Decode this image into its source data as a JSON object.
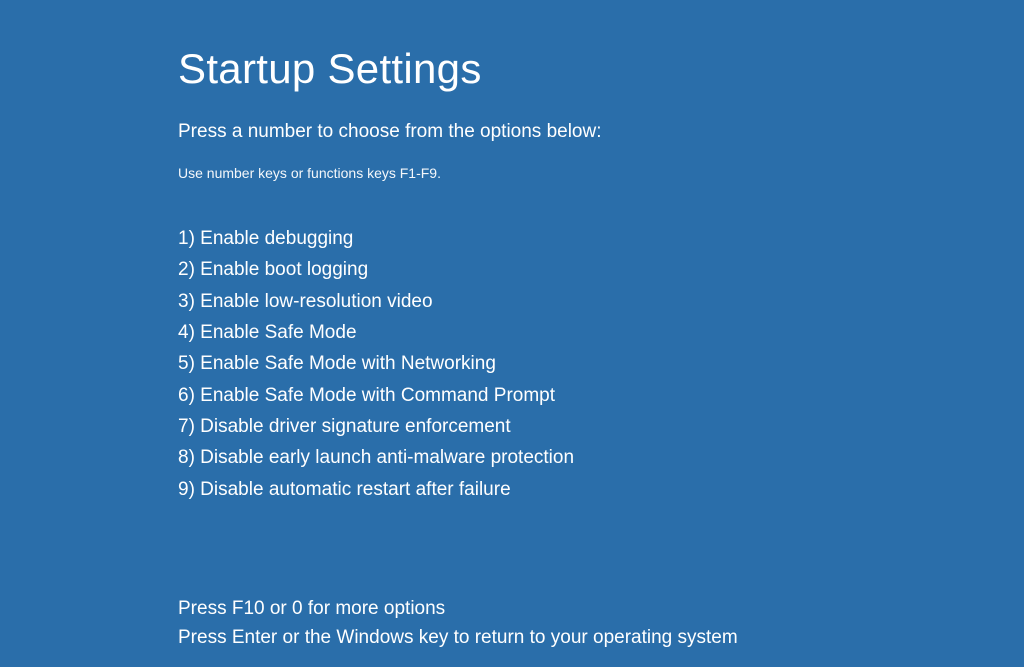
{
  "title": "Startup Settings",
  "subtitle": "Press a number to choose from the options below:",
  "hint": "Use number keys or functions keys F1-F9.",
  "options": [
    "1) Enable debugging",
    "2) Enable boot logging",
    "3) Enable low-resolution video",
    "4) Enable Safe Mode",
    "5) Enable Safe Mode with Networking",
    "6) Enable Safe Mode with Command Prompt",
    "7) Disable driver signature enforcement",
    "8) Disable early launch anti-malware protection",
    "9) Disable automatic restart after failure"
  ],
  "footer": {
    "more_options": "Press F10 or 0 for more options",
    "return": "Press Enter or the Windows key to return to your operating system"
  }
}
